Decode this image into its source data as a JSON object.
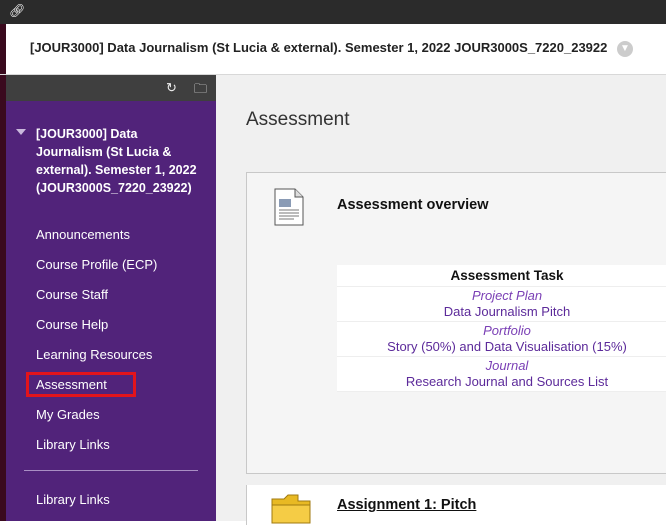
{
  "topbar": {
    "icon": "link-icon"
  },
  "course_header": {
    "title": "[JOUR3000] Data Journalism (St Lucia & external). Semester 1, 2022 JOUR3000S_7220_23922",
    "menu_icon": "chevron-down-icon"
  },
  "sidebar": {
    "toolbar_icons": [
      "refresh-icon",
      "folder-icon"
    ],
    "course_name": "[JOUR3000] Data Journalism (St Lucia & external). Semester 1, 2022 (JOUR3000S_7220_23922)",
    "items": [
      {
        "label": "Announcements"
      },
      {
        "label": "Course Profile (ECP)"
      },
      {
        "label": "Course Staff"
      },
      {
        "label": "Course Help"
      },
      {
        "label": "Learning Resources"
      },
      {
        "label": "Assessment",
        "active": true
      },
      {
        "label": "My Grades"
      },
      {
        "label": "Library Links"
      }
    ],
    "bottom_item": "Library Links"
  },
  "main": {
    "page_title": "Assessment",
    "items": [
      {
        "title": "Assessment overview",
        "icon": "document-icon",
        "table": {
          "header": "Assessment Task",
          "rows": [
            {
              "type": "Project Plan",
              "name": "Data Journalism Pitch"
            },
            {
              "type": "Portfolio",
              "name": "Story (50%) and Data Visualisation (15%)"
            },
            {
              "type": "Journal",
              "name": "Research Journal and Sources List"
            }
          ]
        }
      },
      {
        "title": "Assignment 1: Pitch",
        "icon": "folder-icon"
      }
    ]
  },
  "colors": {
    "sidebar": "#51237a",
    "active_outline": "#e3141b",
    "link": "#5c2a9a"
  }
}
